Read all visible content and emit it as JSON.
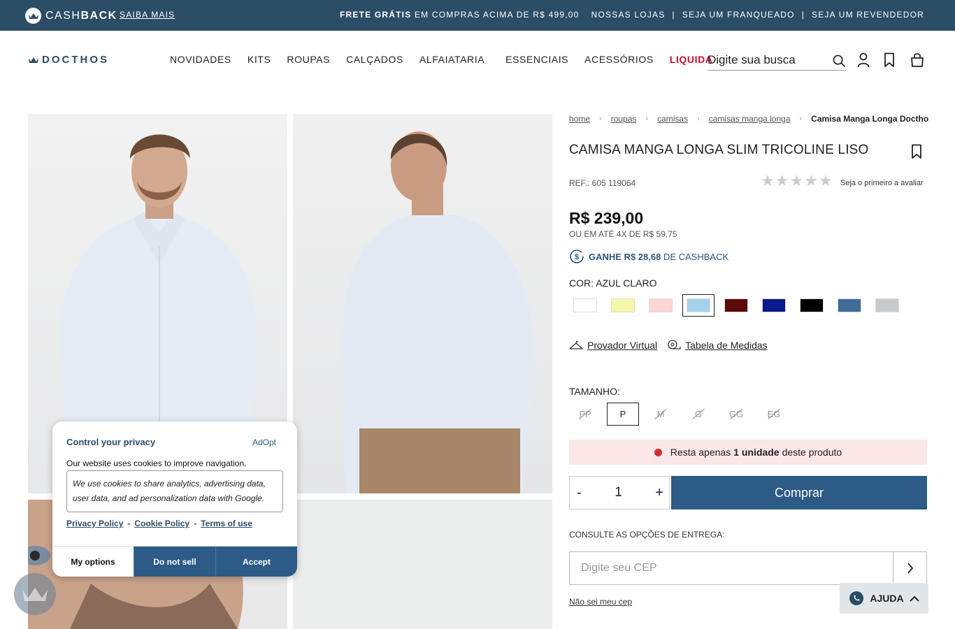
{
  "topbar": {
    "cashback_prefix": "CASH",
    "cashback_suffix": "BACK",
    "saiba_mais": "SAIBA MAIS",
    "frete_bold": "FRETE GRÁTIS",
    "frete_rest": "EM COMPRAS ACIMA DE R$ 499,00",
    "links": [
      "NOSSAS LOJAS",
      "|",
      "SEJA UM FRANQUEADO",
      "|",
      "SEJA UM REVENDEDOR"
    ]
  },
  "header": {
    "brand": "DOCTHOS",
    "nav": [
      "NOVIDADES",
      "KITS",
      "ROUPAS",
      "CALÇADOS",
      "ALFAIATARIA",
      "ESSENCIAIS",
      "ACESSÓRIOS"
    ],
    "nav_sale": "LIQUIDA",
    "search_placeholder": "Digite sua busca"
  },
  "breadcrumb": {
    "items": [
      "home",
      "roupas",
      "camisas",
      "camisas manga longa"
    ],
    "current": "Camisa Manga Longa Doctho"
  },
  "product": {
    "title": "CAMISA MANGA LONGA SLIM TRICOLINE LISO",
    "ref": "REF.: 605 119064",
    "rating_value": 0,
    "rating_max": 5,
    "rating_text": "Seja o primeiro a avaliar",
    "price": "R$ 239,00",
    "installments": "OU EM ATÉ 4X DE R$ 59,75",
    "cashback_bold": "GANHE R$ 28,68",
    "cashback_rest": "DE CASHBACK",
    "color_label": "COR: AZUL CLARO",
    "colors": [
      "#ffffff",
      "#f5f7a8",
      "#fcd5d6",
      "#a6d2ee",
      "#5a0a0a",
      "#0a1a8a",
      "#000000",
      "#3f6d98",
      "#c7cacc"
    ],
    "selected_color_index": 3,
    "provador": "Provador Virtual",
    "tabela": "Tabela de Medidas",
    "size_label": "TAMANHO:",
    "sizes": [
      {
        "label": "PP",
        "available": false
      },
      {
        "label": "P",
        "available": true
      },
      {
        "label": "M",
        "available": false
      },
      {
        "label": "G",
        "available": false
      },
      {
        "label": "GG",
        "available": false
      },
      {
        "label": "EG",
        "available": false
      }
    ],
    "stock_pre": "Resta apenas",
    "stock_bold": "1 unidade",
    "stock_post": "deste produto",
    "qty_minus": "-",
    "qty_value": "1",
    "qty_plus": "+",
    "buy_label": "Comprar",
    "delivery_label": "CONSULTE AS OPÇÕES DE ENTREGA:",
    "cep_placeholder": "Digite seu CEP",
    "nocep": "Não sei meu cep",
    "help": "AJUDA"
  },
  "cookie": {
    "title": "Control your privacy",
    "brand": "AdOpt",
    "text": "Our website uses cookies to improve navigation.",
    "box": "We use cookies to share analytics, advertising data, user data, and ad personalization data with Google.",
    "links": [
      "Privacy Policy",
      "Cookie Policy",
      "Terms of use"
    ],
    "link_sep": "-",
    "buttons": [
      "My options",
      "Do not sell",
      "Accept"
    ]
  },
  "colors": {
    "topbar": "#2b4d66",
    "primary": "#2b5b86",
    "sale": "#c8102e",
    "stock_bg": "#fbe6e8"
  }
}
